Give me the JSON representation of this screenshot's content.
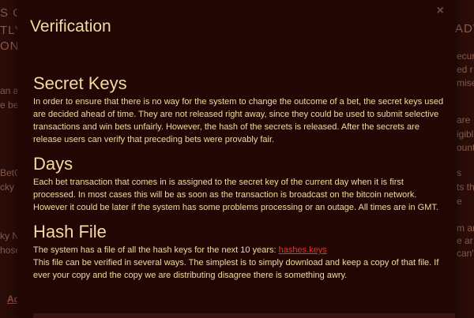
{
  "background": {
    "fragments": [
      "S C",
      "TLY",
      "ONA",
      "ADV",
      "an a",
      "e be",
      "ecur",
      "ed r",
      "mise",
      "are",
      "igibl",
      "ount",
      "BetC",
      "cky I",
      "s",
      "ts th",
      "e",
      "ky N",
      "hose",
      "m an",
      "e ar",
      "can't",
      "Ad"
    ]
  },
  "modal": {
    "title": "Verification",
    "close_symbol": "×",
    "sections": [
      {
        "heading": "Secret Keys",
        "text": "In order to ensure that there is no way for the system to change the outcome of a bet, the secret keys used are decided ahead of time. They are not released right away, since they could be used to submit selective transactions and win bets unfairly. However, the hash of the secrets is released. After the secrets are release users can verify that preceding bets were provably fair."
      },
      {
        "heading": "Days",
        "text": "Each bet transaction that comes in is assigned to the secret key of the current day when it is first processed. In most cases this will be as soon as the transaction is broadcast on the bitcoin network. However it could be later if the system has some problems processing or an outage. All times are in GMT."
      },
      {
        "heading": "Hash File",
        "text_prefix": "The system has a file of all the hash keys for the next 10 years: ",
        "link_text": "hashes.keys",
        "text_suffix": "This file can be verified in several ways. The simplest is to simply download and keep a copy of that file. If ever your copy and the copy we are distributing disagree there is something awry."
      }
    ]
  },
  "colors": {
    "text": "#f4d9a0",
    "link": "#e8332a",
    "modal_bg": "#220603"
  }
}
